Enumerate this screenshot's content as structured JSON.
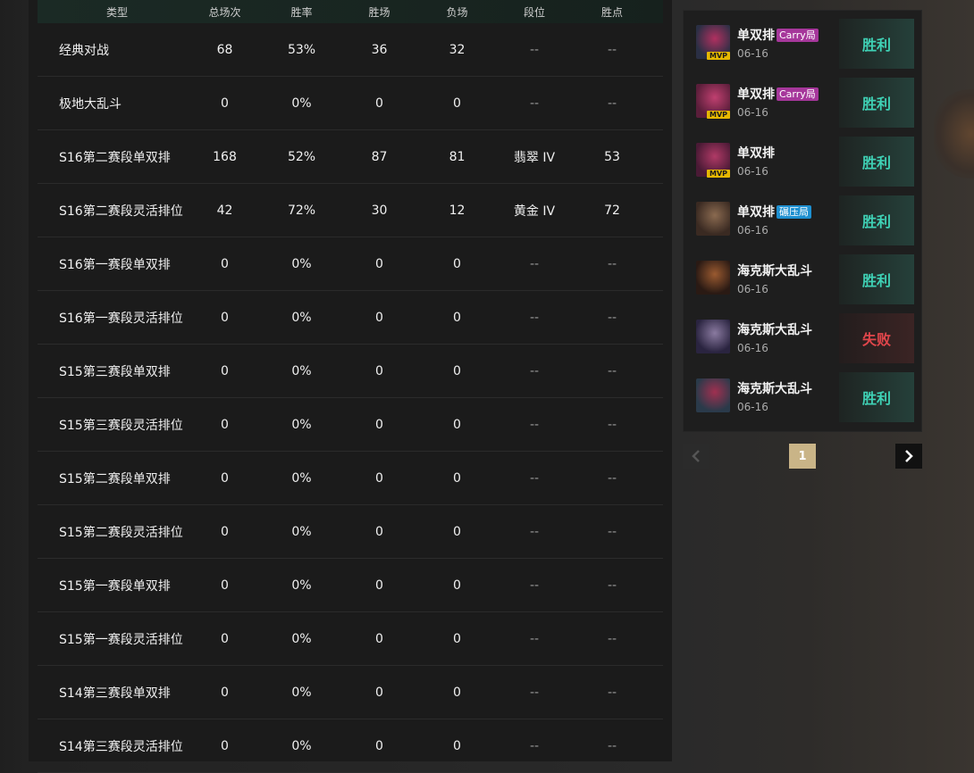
{
  "table": {
    "headers": {
      "type": "类型",
      "total": "总场次",
      "rate": "胜率",
      "wins": "胜场",
      "losses": "负场",
      "rank": "段位",
      "points": "胜点"
    },
    "rows": [
      {
        "type": "经典对战",
        "total": "68",
        "rate": "53%",
        "wins": "36",
        "losses": "32",
        "rank": "--",
        "points": "--"
      },
      {
        "type": "极地大乱斗",
        "total": "0",
        "rate": "0%",
        "wins": "0",
        "losses": "0",
        "rank": "--",
        "points": "--"
      },
      {
        "type": "S16第二赛段单双排",
        "total": "168",
        "rate": "52%",
        "wins": "87",
        "losses": "81",
        "rank": "翡翠 IV",
        "points": "53"
      },
      {
        "type": "S16第二赛段灵活排位",
        "total": "42",
        "rate": "72%",
        "wins": "30",
        "losses": "12",
        "rank": "黄金 IV",
        "points": "72"
      },
      {
        "type": "S16第一赛段单双排",
        "total": "0",
        "rate": "0%",
        "wins": "0",
        "losses": "0",
        "rank": "--",
        "points": "--"
      },
      {
        "type": "S16第一赛段灵活排位",
        "total": "0",
        "rate": "0%",
        "wins": "0",
        "losses": "0",
        "rank": "--",
        "points": "--"
      },
      {
        "type": "S15第三赛段单双排",
        "total": "0",
        "rate": "0%",
        "wins": "0",
        "losses": "0",
        "rank": "--",
        "points": "--"
      },
      {
        "type": "S15第三赛段灵活排位",
        "total": "0",
        "rate": "0%",
        "wins": "0",
        "losses": "0",
        "rank": "--",
        "points": "--"
      },
      {
        "type": "S15第二赛段单双排",
        "total": "0",
        "rate": "0%",
        "wins": "0",
        "losses": "0",
        "rank": "--",
        "points": "--"
      },
      {
        "type": "S15第二赛段灵活排位",
        "total": "0",
        "rate": "0%",
        "wins": "0",
        "losses": "0",
        "rank": "--",
        "points": "--"
      },
      {
        "type": "S15第一赛段单双排",
        "total": "0",
        "rate": "0%",
        "wins": "0",
        "losses": "0",
        "rank": "--",
        "points": "--"
      },
      {
        "type": "S15第一赛段灵活排位",
        "total": "0",
        "rate": "0%",
        "wins": "0",
        "losses": "0",
        "rank": "--",
        "points": "--"
      },
      {
        "type": "S14第三赛段单双排",
        "total": "0",
        "rate": "0%",
        "wins": "0",
        "losses": "0",
        "rank": "--",
        "points": "--"
      },
      {
        "type": "S14第三赛段灵活排位",
        "total": "0",
        "rate": "0%",
        "wins": "0",
        "losses": "0",
        "rank": "--",
        "points": "--"
      }
    ]
  },
  "matches": [
    {
      "mode": "单双排",
      "tag": "Carry局",
      "tag_kind": "carry",
      "mvp": "MVP",
      "date": "06-16",
      "result": "胜利",
      "win": true,
      "avatar_colors": [
        "#2a2f44",
        "#b03060"
      ]
    },
    {
      "mode": "单双排",
      "tag": "Carry局",
      "tag_kind": "carry",
      "mvp": "MVP",
      "date": "06-16",
      "result": "胜利",
      "win": true,
      "avatar_colors": [
        "#5a1e3a",
        "#c04070"
      ]
    },
    {
      "mode": "单双排",
      "tag": "",
      "tag_kind": "",
      "mvp": "MVP",
      "date": "06-16",
      "result": "胜利",
      "win": true,
      "avatar_colors": [
        "#4a1a35",
        "#b03a66"
      ]
    },
    {
      "mode": "单双排",
      "tag": "碾压局",
      "tag_kind": "crush",
      "mvp": "",
      "date": "06-16",
      "result": "胜利",
      "win": true,
      "avatar_colors": [
        "#3a2a22",
        "#8a6a50"
      ]
    },
    {
      "mode": "海克斯大乱斗",
      "tag": "",
      "tag_kind": "",
      "mvp": "",
      "date": "06-16",
      "result": "胜利",
      "win": true,
      "avatar_colors": [
        "#2a1a14",
        "#9a5a30"
      ]
    },
    {
      "mode": "海克斯大乱斗",
      "tag": "",
      "tag_kind": "",
      "mvp": "",
      "date": "06-16",
      "result": "失败",
      "win": false,
      "avatar_colors": [
        "#2a2440",
        "#8a7aa0"
      ]
    },
    {
      "mode": "海克斯大乱斗",
      "tag": "",
      "tag_kind": "",
      "mvp": "",
      "date": "06-16",
      "result": "胜利",
      "win": true,
      "avatar_colors": [
        "#2a3a4a",
        "#a03050"
      ]
    }
  ],
  "pager": {
    "prev_icon": "chevron-left-icon",
    "current": "1",
    "next_icon": "chevron-right-icon"
  }
}
